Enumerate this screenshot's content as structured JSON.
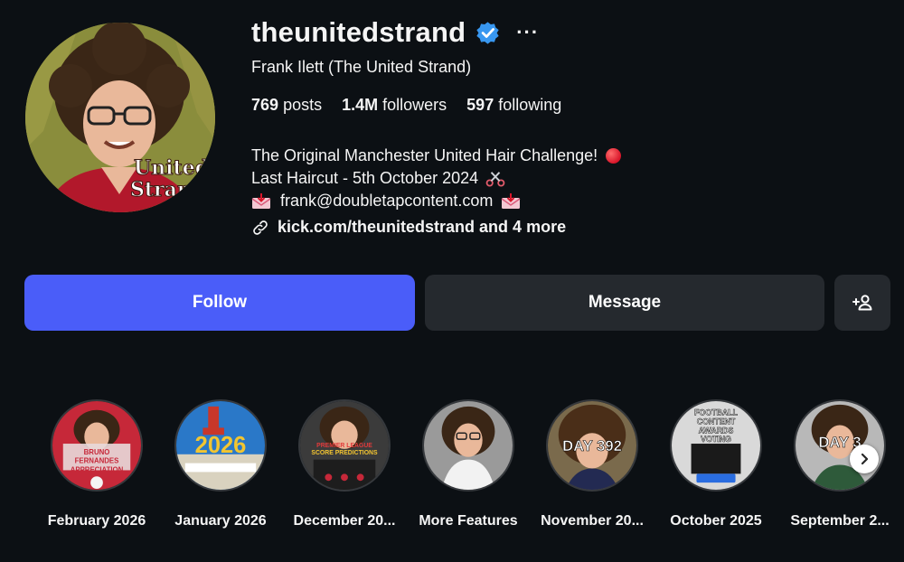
{
  "profile": {
    "username": "theunitedstrand",
    "more_label": "···",
    "full_name": "Frank Ilett (The United Strand)",
    "avatar_logo_text": "United Strand"
  },
  "stats": [
    {
      "value": "769",
      "label": "posts"
    },
    {
      "value": "1.4M",
      "label": "followers"
    },
    {
      "value": "597",
      "label": "following"
    }
  ],
  "bio": {
    "line1": "The Original Manchester United Hair Challenge!",
    "line2": "Last Haircut - 5th October 2024",
    "email": "frank@doubletapcontent.com",
    "link": "kick.com/theunitedstrand and 4 more"
  },
  "actions": {
    "follow": "Follow",
    "message": "Message"
  },
  "highlights": [
    {
      "label": "February 2026",
      "thumb_text": "BRUNO FERNANDES APPRECIATION"
    },
    {
      "label": "January 2026",
      "thumb_text": "2026"
    },
    {
      "label": "December 20...",
      "thumb_text": "PREMIER LEAGUE SCORE PREDICTIONS"
    },
    {
      "label": "More Features",
      "thumb_text": ""
    },
    {
      "label": "November 20...",
      "thumb_text": "DAY 392"
    },
    {
      "label": "October 2025",
      "thumb_text": "FOOTBALL CONTENT AWARDS VOTING"
    },
    {
      "label": "September 2...",
      "thumb_text": "DAY 3"
    }
  ],
  "colors": {
    "background": "#0c1014",
    "follow_button": "#4a5df9",
    "secondary_button": "#25292e",
    "verified_badge": "#3897f0"
  },
  "icons": {
    "verified": "verified-badge-icon",
    "link": "link-icon",
    "suggest": "add-person-icon",
    "next": "chevron-right-icon",
    "scissors": "scissors-icon",
    "mail": "incoming-envelope-icon"
  }
}
